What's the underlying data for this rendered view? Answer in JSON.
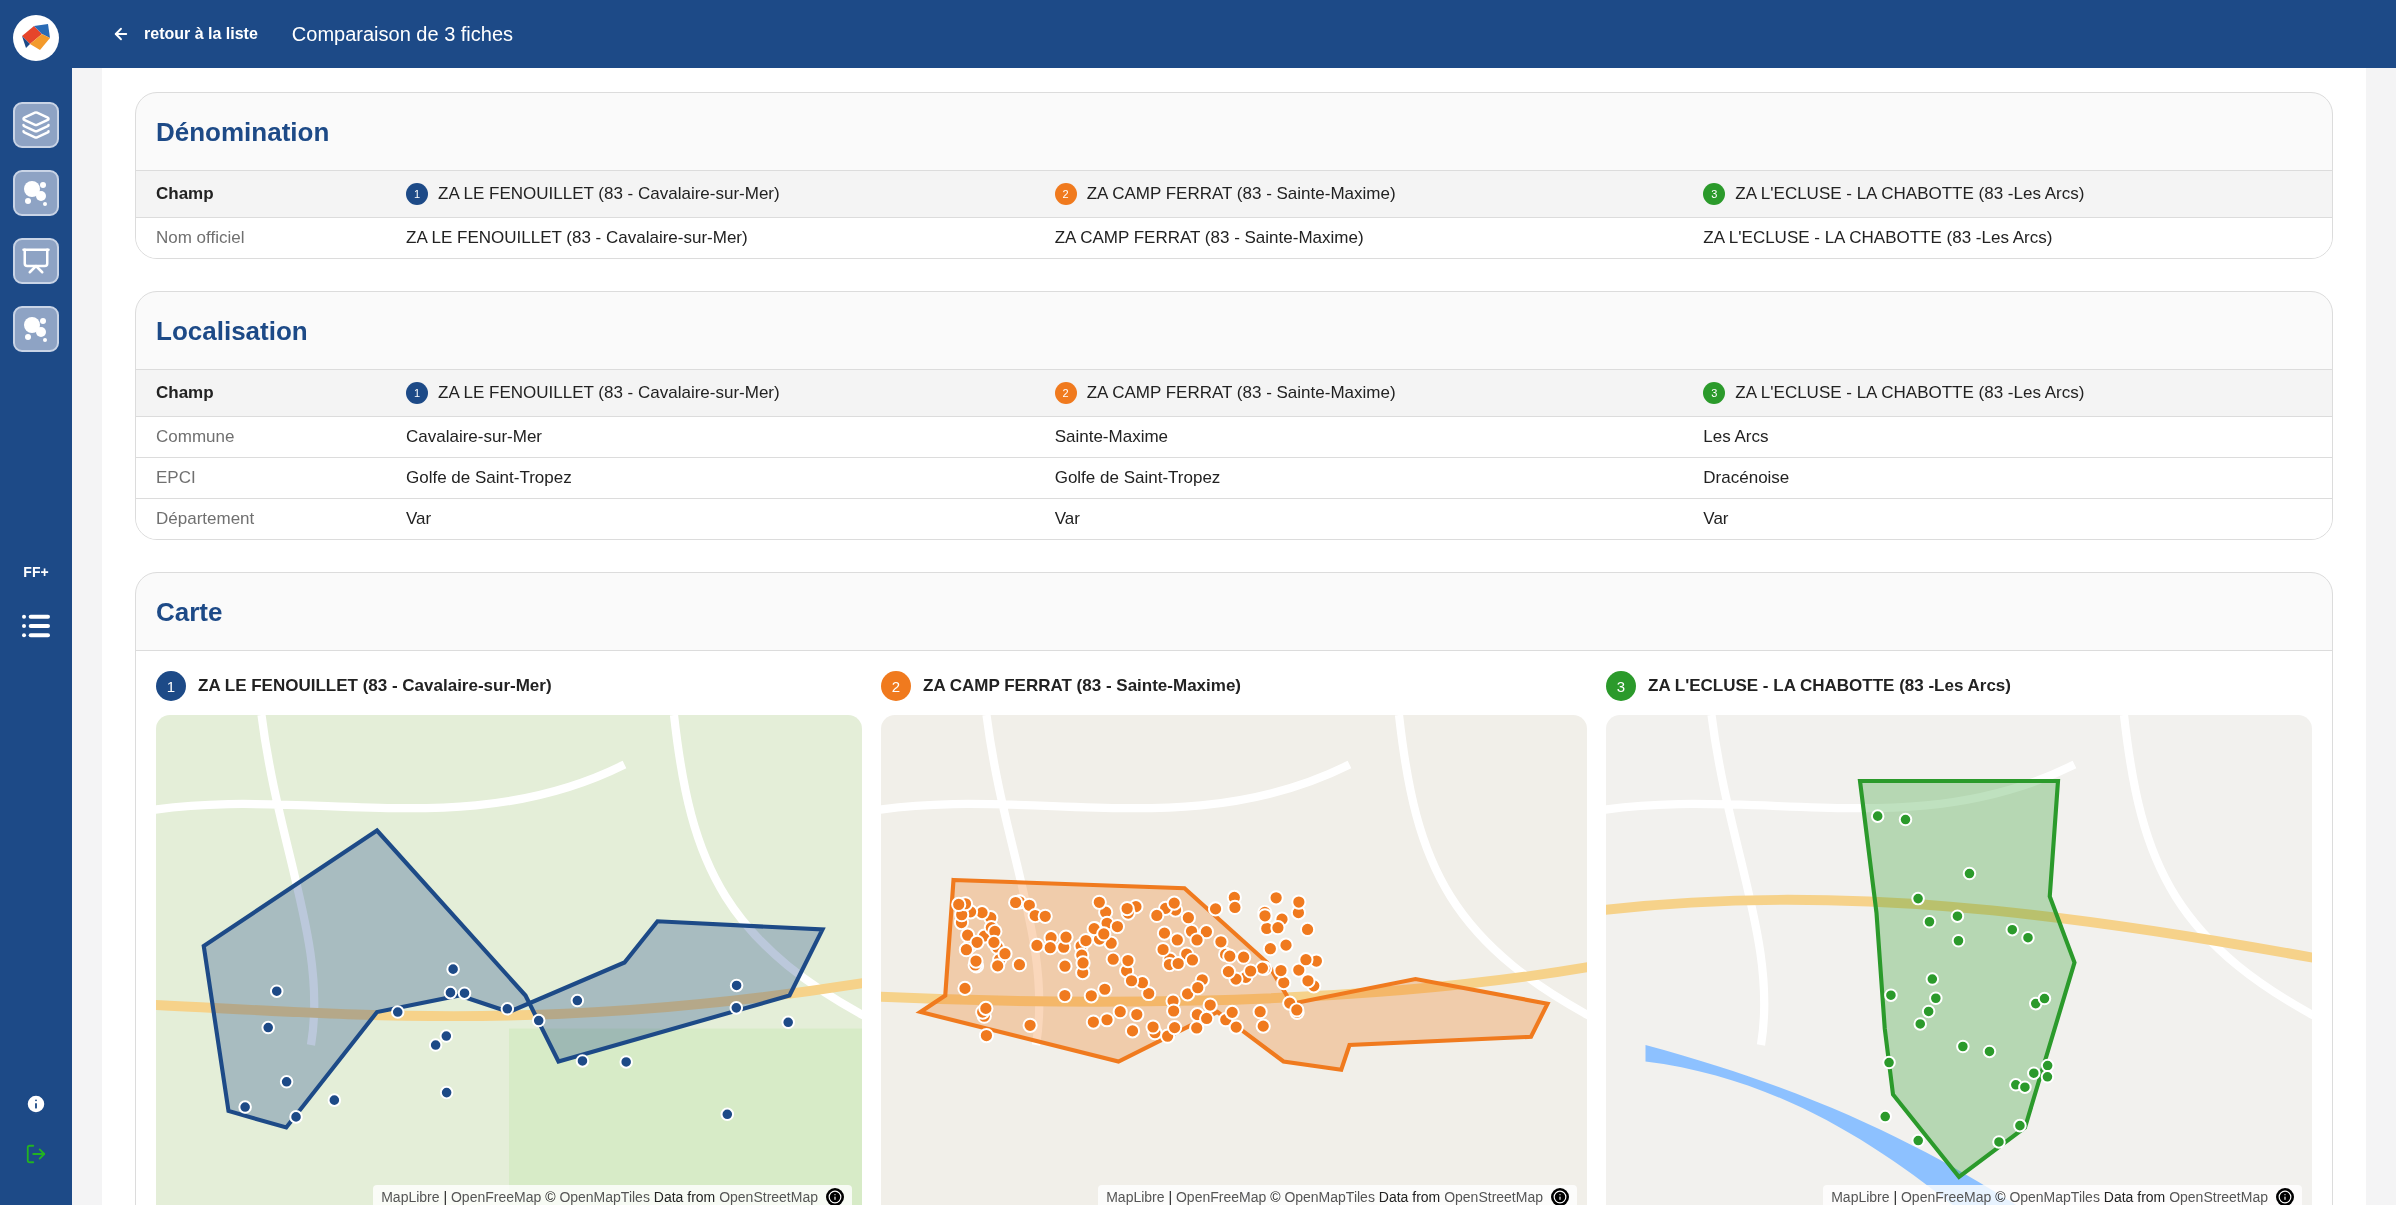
{
  "sidebar": {
    "items": [
      {
        "kind": "layers",
        "selected": false
      },
      {
        "kind": "bubbles",
        "selected": false
      },
      {
        "kind": "presentation",
        "selected": false
      },
      {
        "kind": "bubbles",
        "selected": false
      }
    ],
    "badge_text": "FF+"
  },
  "topbar": {
    "back_link": "retour à la liste",
    "title": "Comparaison de 3 fiches"
  },
  "sections": [
    {
      "title": "Dénomination",
      "header_label": "Champ",
      "columns": [
        {
          "number": "1",
          "name": "ZA LE FENOUILLET (83 - Cavalaire-sur-Mer)",
          "color": "#1d4a87"
        },
        {
          "number": "2",
          "name": "ZA CAMP FERRAT (83 - Sainte-Maxime)",
          "color": "#f07a1e"
        },
        {
          "number": "3",
          "name": "ZA L'ECLUSE - LA CHABOTTE (83 -Les Arcs)",
          "color": "#2b9a2b"
        }
      ],
      "rows": [
        {
          "label": "Nom officiel",
          "values": [
            "ZA LE FENOUILLET (83 - Cavalaire-sur-Mer)",
            "ZA CAMP FERRAT (83 - Sainte-Maxime)",
            "ZA L'ECLUSE - LA CHABOTTE (83 -Les Arcs)"
          ]
        }
      ]
    },
    {
      "title": "Localisation",
      "header_label": "Champ",
      "columns": [
        {
          "number": "1",
          "name": "ZA LE FENOUILLET (83 - Cavalaire-sur-Mer)",
          "color": "#1d4a87"
        },
        {
          "number": "2",
          "name": "ZA CAMP FERRAT (83 - Sainte-Maxime)",
          "color": "#f07a1e"
        },
        {
          "number": "3",
          "name": "ZA L'ECLUSE - LA CHABOTTE (83 -Les Arcs)",
          "color": "#2b9a2b"
        }
      ],
      "rows": [
        {
          "label": "Commune",
          "values": [
            "Cavalaire-sur-Mer",
            "Sainte-Maxime",
            "Les Arcs"
          ]
        },
        {
          "label": "EPCI",
          "values": [
            "Golfe de Saint-Tropez",
            "Golfe de Saint-Tropez",
            "Dracénoise"
          ]
        },
        {
          "label": "Département",
          "values": [
            "Var",
            "Var",
            "Var"
          ]
        }
      ]
    }
  ],
  "map_section": {
    "title": "Carte",
    "maps": [
      {
        "number": "1",
        "name": "ZA LE FENOUILLET (83 - Cavalaire-sur-Mer)",
        "color": "#1d4a87",
        "attribution": [
          {
            "text": "MapLibre",
            "kind": "link"
          },
          {
            "text": " | ",
            "kind": "plain"
          },
          {
            "text": "OpenFreeMap",
            "kind": "link"
          },
          {
            "text": " © ",
            "kind": "plain"
          },
          {
            "text": "OpenMapTiles",
            "kind": "link"
          },
          {
            "text": " Data from ",
            "kind": "plain"
          },
          {
            "text": "OpenStreetMap",
            "kind": "link"
          }
        ]
      },
      {
        "number": "2",
        "name": "ZA CAMP FERRAT (83 - Sainte-Maxime)",
        "color": "#f07a1e",
        "attribution": [
          {
            "text": "MapLibre",
            "kind": "link"
          },
          {
            "text": " | ",
            "kind": "plain"
          },
          {
            "text": "OpenFreeMap",
            "kind": "link"
          },
          {
            "text": " © ",
            "kind": "plain"
          },
          {
            "text": "OpenMapTiles",
            "kind": "link"
          },
          {
            "text": " Data from ",
            "kind": "plain"
          },
          {
            "text": "OpenStreetMap",
            "kind": "link"
          }
        ]
      },
      {
        "number": "3",
        "name": "ZA L'ECLUSE - LA CHABOTTE (83 -Les Arcs)",
        "color": "#2b9a2b",
        "attribution": [
          {
            "text": "MapLibre",
            "kind": "link"
          },
          {
            "text": " | ",
            "kind": "plain"
          },
          {
            "text": "OpenFreeMap",
            "kind": "link"
          },
          {
            "text": " © ",
            "kind": "plain"
          },
          {
            "text": "OpenMapTiles",
            "kind": "link"
          },
          {
            "text": " Data from ",
            "kind": "plain"
          },
          {
            "text": "OpenStreetMap",
            "kind": "link"
          }
        ]
      }
    ]
  }
}
